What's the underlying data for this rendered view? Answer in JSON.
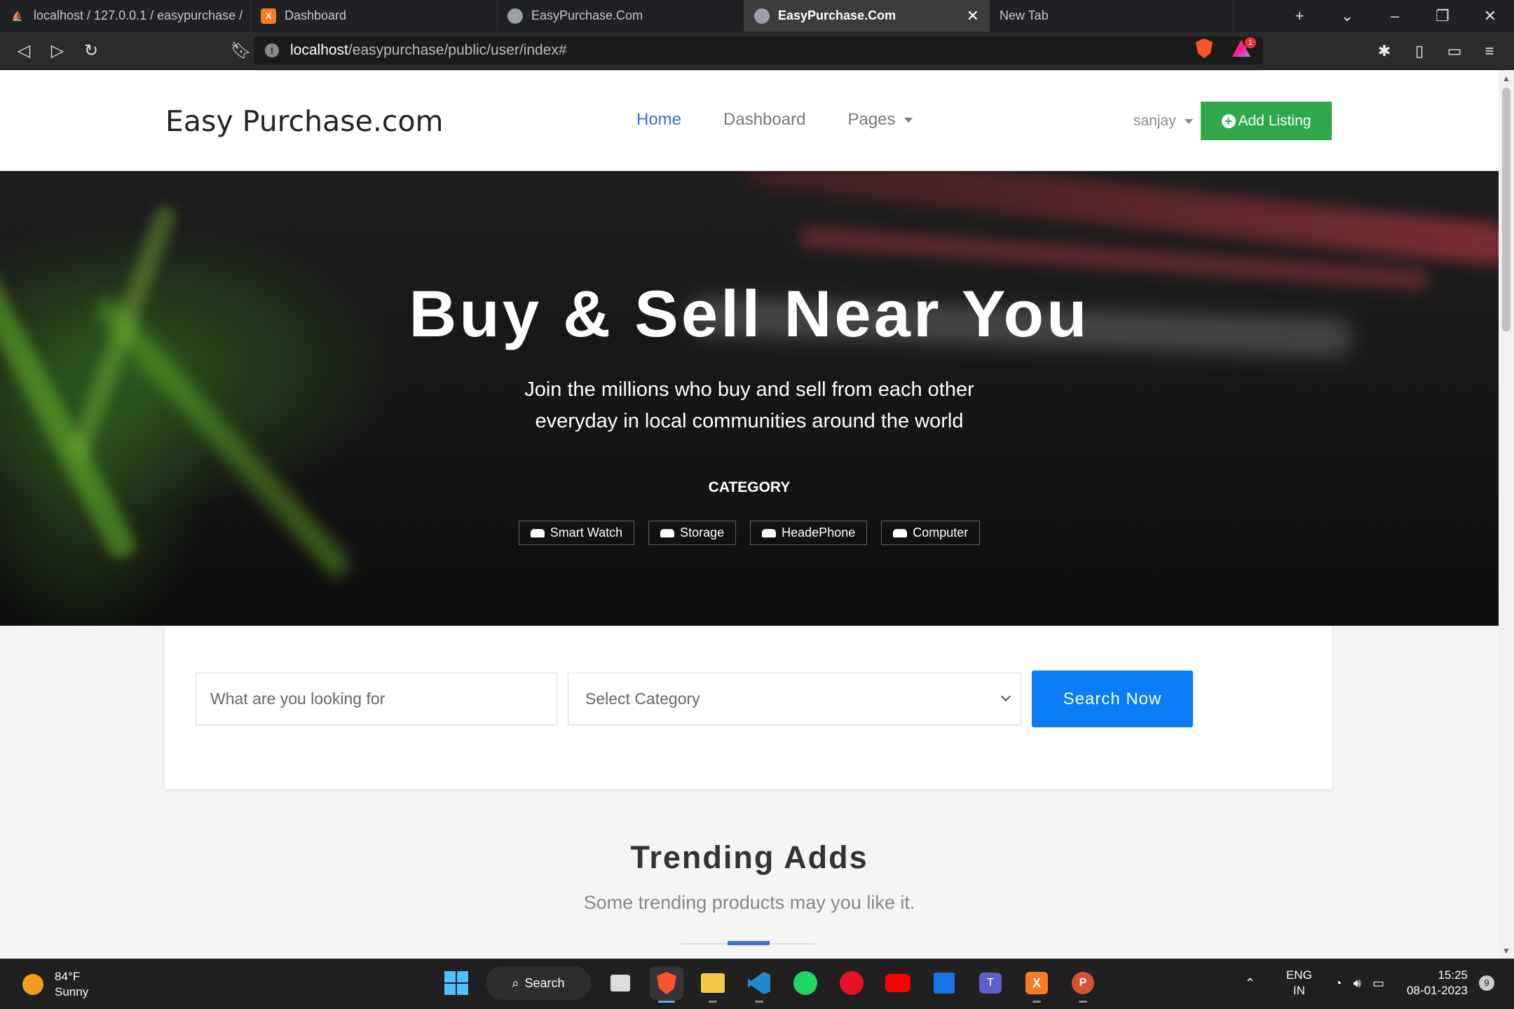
{
  "browser": {
    "tabs": [
      {
        "title": "localhost / 127.0.0.1 / easypurchase /",
        "icon": "phpmyadmin-icon",
        "color": "#f29111"
      },
      {
        "title": "Dashboard",
        "icon": "xampp-icon",
        "color": "#fb7a24"
      },
      {
        "title": "EasyPurchase.Com",
        "icon": "globe-icon",
        "color": "#9aa0a6"
      },
      {
        "title": "EasyPurchase.Com",
        "icon": "globe-icon",
        "color": "#9aa0a6",
        "active": true
      },
      {
        "title": "New Tab",
        "icon": "",
        "color": ""
      }
    ],
    "url_host": "localhost",
    "url_path": "/easypurchase/public/user/index#",
    "rewards_badge": "1"
  },
  "header": {
    "brand": "Easy Purchase.com",
    "nav": [
      "Home",
      "Dashboard",
      "Pages"
    ],
    "user": "sanjay",
    "add_listing": "Add Listing"
  },
  "hero": {
    "title": "Buy & Sell Near You",
    "subtitle_line1": "Join the millions who buy and sell from each other",
    "subtitle_line2": "everyday in local communities around the world",
    "category_label": "CATEGORY",
    "categories": [
      "Smart Watch",
      "Storage",
      "HeadePhone",
      "Computer"
    ]
  },
  "search": {
    "placeholder": "What are you looking for",
    "select_value": "Select Category",
    "button": "Search Now"
  },
  "trending": {
    "title": "Trending Adds",
    "subtitle": "Some trending products may you like it."
  },
  "taskbar": {
    "temp": "84°F",
    "condition": "Sunny",
    "search_label": "Search",
    "lang1": "ENG",
    "lang2": "IN",
    "time": "15:25",
    "date": "08-01-2023",
    "notifications": "9"
  },
  "colors": {
    "accent": "#3b6fd6",
    "add_listing_bg": "#2ea84a",
    "search_button_bg": "#0a7cf5"
  }
}
